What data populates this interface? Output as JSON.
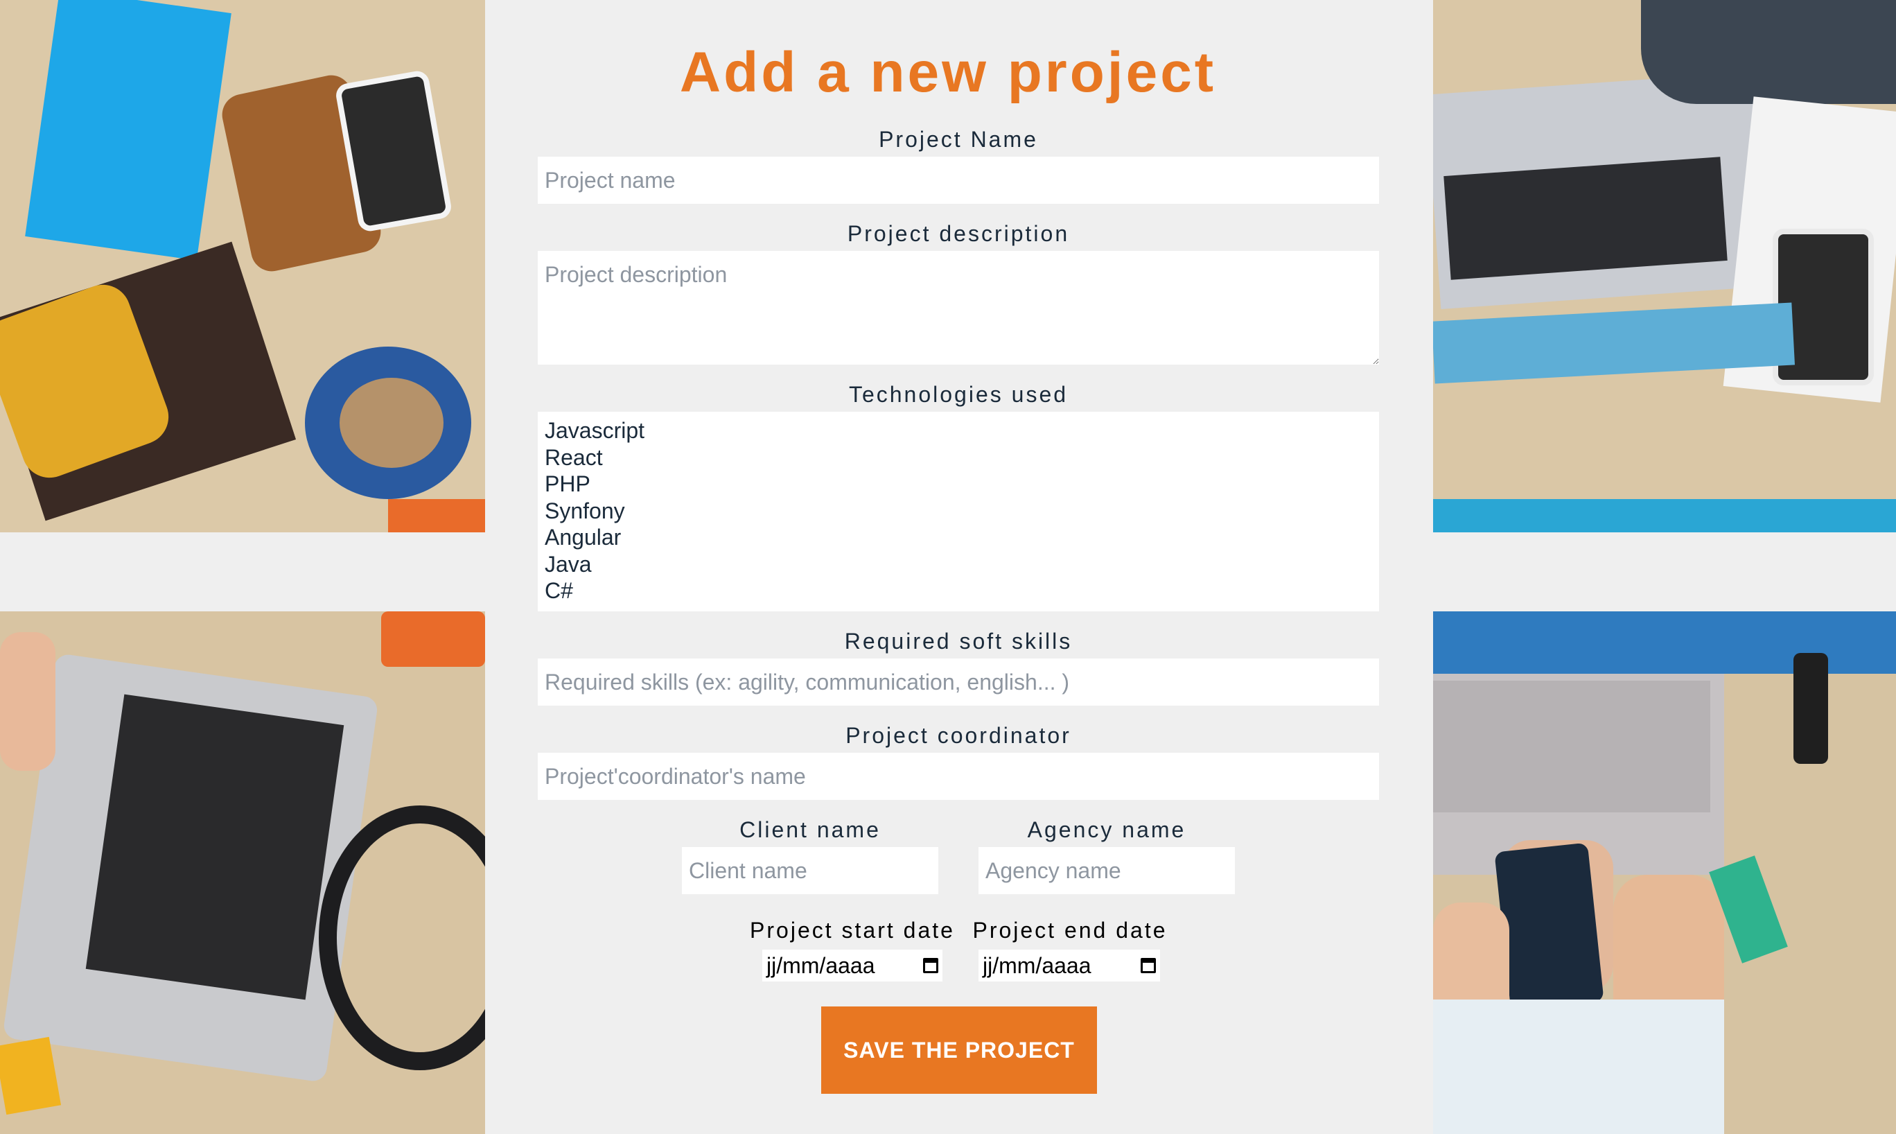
{
  "page": {
    "title": "Add a new project"
  },
  "fields": {
    "project_name": {
      "label": "Project Name",
      "placeholder": "Project name"
    },
    "project_description": {
      "label": "Project description",
      "placeholder": "Project description"
    },
    "technologies": {
      "label": "Technologies used",
      "options": [
        "Javascript",
        "React",
        "PHP",
        "Synfony",
        "Angular",
        "Java",
        "C#"
      ]
    },
    "soft_skills": {
      "label": "Required soft skills",
      "placeholder": "Required skills (ex: agility, communication, english... )"
    },
    "coordinator": {
      "label": "Project coordinator",
      "placeholder": "Project'coordinator's name"
    },
    "client_name": {
      "label": "Client name",
      "placeholder": "Client name"
    },
    "agency_name": {
      "label": "Agency name",
      "placeholder": "Agency name"
    },
    "start_date": {
      "label": "Project start date",
      "value": "jj/mm/aaaa"
    },
    "end_date": {
      "label": "Project end date",
      "value": "jj/mm/aaaa"
    }
  },
  "actions": {
    "save_label": "SAVE THE PROJECT"
  },
  "colors": {
    "accent": "#e87722",
    "panel": "#efefef",
    "text": "#1a2a3a"
  },
  "icons": {
    "date_picker": "calendar-icon"
  }
}
